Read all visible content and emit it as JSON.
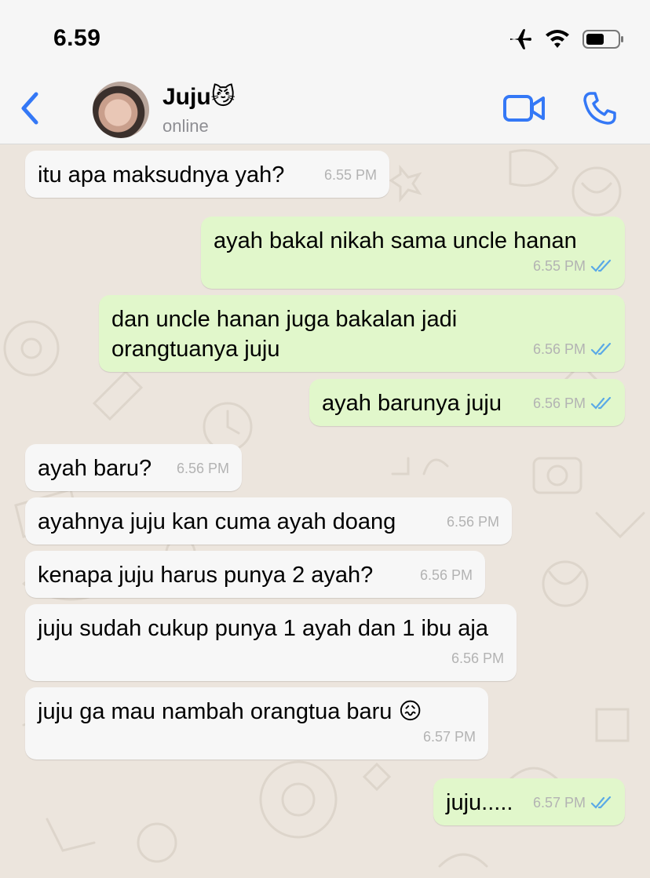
{
  "status": {
    "time": "6.59"
  },
  "contact": {
    "name": "Juju😼",
    "status": "online"
  },
  "messages": [
    {
      "dir": "in",
      "text": "itu apa maksudnya yah?",
      "time": "6.55 PM"
    },
    {
      "dir": "out",
      "text": "ayah bakal nikah sama uncle hanan",
      "time": "6.55 PM"
    },
    {
      "dir": "out",
      "text": "dan uncle hanan juga bakalan jadi orangtuanya juju",
      "time": "6.56 PM"
    },
    {
      "dir": "out",
      "text": "ayah barunya juju",
      "time": "6.56 PM"
    },
    {
      "dir": "in",
      "text": "ayah baru?",
      "time": "6.56 PM"
    },
    {
      "dir": "in",
      "text": "ayahnya juju kan cuma ayah doang",
      "time": "6.56 PM"
    },
    {
      "dir": "in",
      "text": "kenapa juju harus punya 2 ayah?",
      "time": "6.56 PM"
    },
    {
      "dir": "in",
      "text": "juju sudah cukup punya 1 ayah dan 1 ibu aja",
      "time": "6.56 PM"
    },
    {
      "dir": "in",
      "text": "juju ga mau nambah orangtua baru 😖",
      "time": "6.57 PM"
    },
    {
      "dir": "out",
      "text": "juju.....",
      "time": "6.57 PM"
    }
  ],
  "colors": {
    "accent": "#3478f6",
    "incoming_bubble": "#f7f7f7",
    "outgoing_bubble": "#e1f7cb",
    "chat_background": "#ece5dd",
    "read_tick": "#5aa9e6"
  },
  "icons": [
    "airplane-icon",
    "wifi-icon",
    "battery-icon",
    "back-chevron-icon",
    "video-call-icon",
    "phone-icon",
    "double-check-icon"
  ]
}
